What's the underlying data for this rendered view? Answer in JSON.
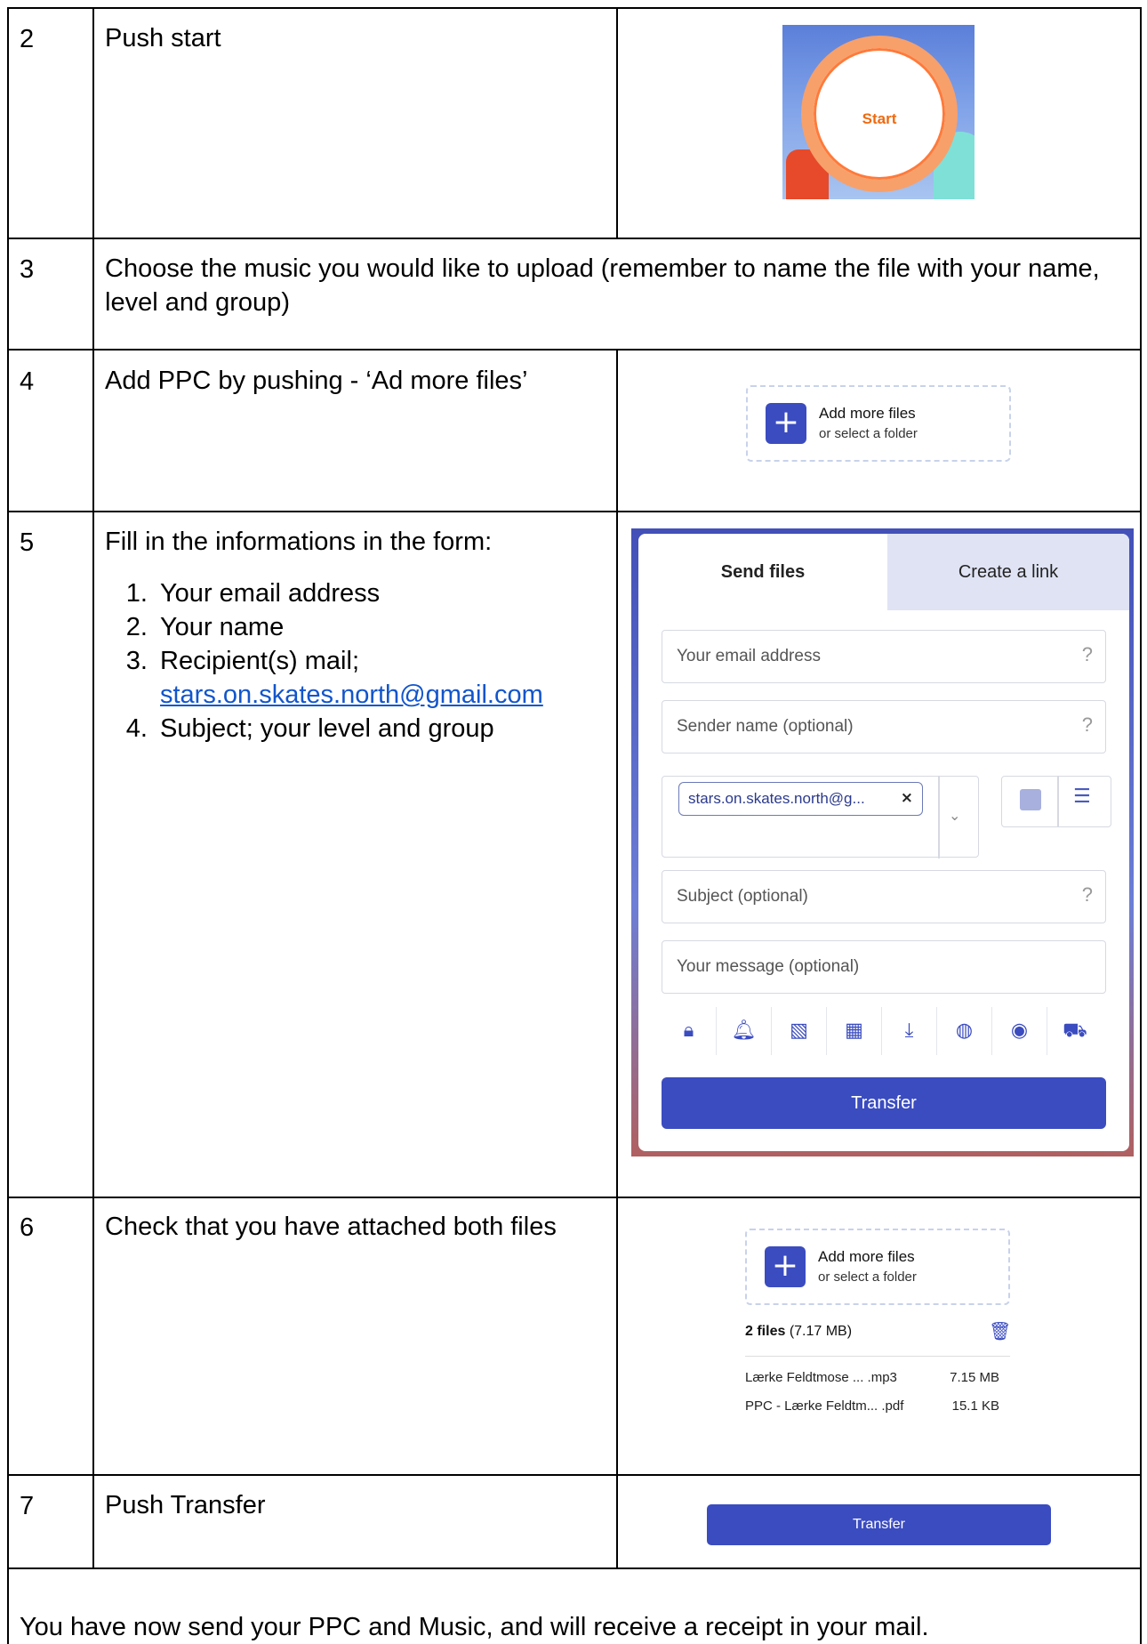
{
  "rows": [
    {
      "num": "2",
      "text": "Push start"
    },
    {
      "num": "3",
      "text": "Choose the music  you would like to upload (remember to name the file with your name, level and group)"
    },
    {
      "num": "4",
      "text": "Add PPC by pushing - ‘Ad more files’"
    },
    {
      "num": "5",
      "text": "Fill in the informations in the form:"
    },
    {
      "num": "6",
      "text": "Check that you have attached both files"
    },
    {
      "num": "7",
      "text": "Push Transfer"
    }
  ],
  "steps": {
    "item1": "Your email address",
    "item2": "Your name",
    "item3": "Recipient(s) mail;",
    "item3_link": "stars.on.skates.north@gmail.com",
    "item4": "Subject; your level and group"
  },
  "footer": "You have now send your PPC and Music, and will receive a receipt in your mail.",
  "start_widget": {
    "label": "Start"
  },
  "add_files": {
    "title": "Add more files",
    "subtitle": "or select a folder"
  },
  "form": {
    "tab_send": "Send files",
    "tab_link": "Create a link",
    "email_placeholder": "Your email address",
    "sender_placeholder": "Sender name (optional)",
    "recipient_chip": "stars.on.skates.north@g...",
    "subject_placeholder": "Subject (optional)",
    "message_placeholder": "Your message (optional)",
    "help": "?",
    "chip_remove": "×",
    "transfer_label": "Transfer",
    "option_icons": [
      "lock-icon",
      "bell-icon",
      "image-icon",
      "calendar-icon",
      "download-icon",
      "globe-icon",
      "eye-icon",
      "cart-icon"
    ]
  },
  "files": {
    "count_label": "2 files",
    "total_size": "(7.17 MB)",
    "items": [
      {
        "name": "Lærke Feldtmose ...  .mp3",
        "size": "7.15 MB"
      },
      {
        "name": "PPC - Lærke Feldtm... .pdf",
        "size": "15.1 KB"
      }
    ]
  },
  "transfer_button": "Transfer",
  "colors": {
    "accent": "#3b4cc0",
    "start_orange": "#ee6a10",
    "link": "#1155cc"
  }
}
